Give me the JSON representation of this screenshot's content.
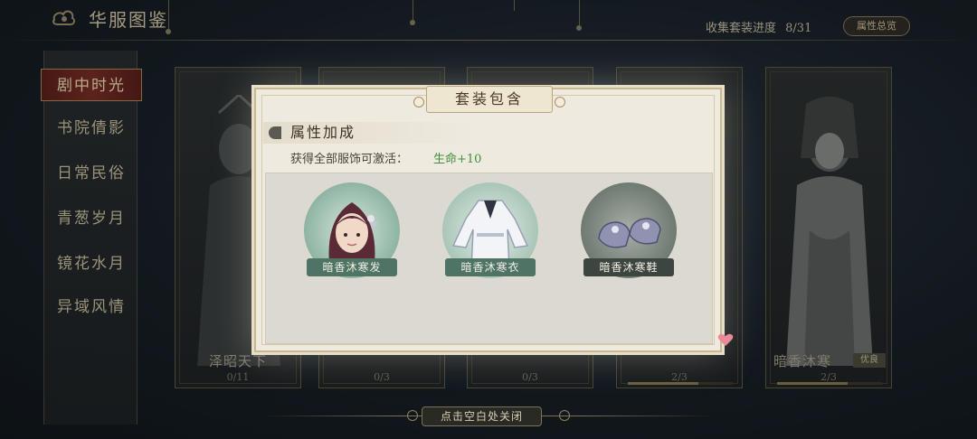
{
  "header": {
    "title": "华服图鉴",
    "progress_label": "收集套装进度",
    "progress_value": "8/31",
    "attr_button": "属性总览"
  },
  "sidebar": {
    "items": [
      {
        "label": "剧中时光",
        "active": true
      },
      {
        "label": "书院倩影",
        "active": false
      },
      {
        "label": "日常民俗",
        "active": false
      },
      {
        "label": "青葱岁月",
        "active": false
      },
      {
        "label": "镜花水月",
        "active": false
      },
      {
        "label": "异域风情",
        "active": false
      }
    ]
  },
  "cards": [
    {
      "name": "泽昭天下",
      "count": "0/11",
      "progress": 0.0
    },
    {
      "name": "",
      "count": "0/3",
      "progress": 0.0
    },
    {
      "name": "",
      "count": "0/3",
      "progress": 0.0
    },
    {
      "name": "",
      "count": "2/3",
      "progress": 0.67
    },
    {
      "name": "暗香沐寒",
      "count": "2/3",
      "progress": 0.67,
      "tag": "优良"
    }
  ],
  "modal": {
    "title": "套装包含",
    "section_label": "属性加成",
    "activate_text": "获得全部服饰可激活：",
    "bonus_text": "生命+10",
    "items": [
      {
        "label": "暗香沐寒发",
        "icon": "hair-icon"
      },
      {
        "label": "暗香沐寒衣",
        "icon": "robe-icon"
      },
      {
        "label": "暗香沐寒鞋",
        "icon": "shoes-icon"
      }
    ]
  },
  "footer": {
    "close_hint": "点击空白处关闭"
  },
  "colors": {
    "accent_red": "#7a2a22",
    "bonus_green": "#3f8f3a",
    "gold_border": "#c9b88f"
  }
}
